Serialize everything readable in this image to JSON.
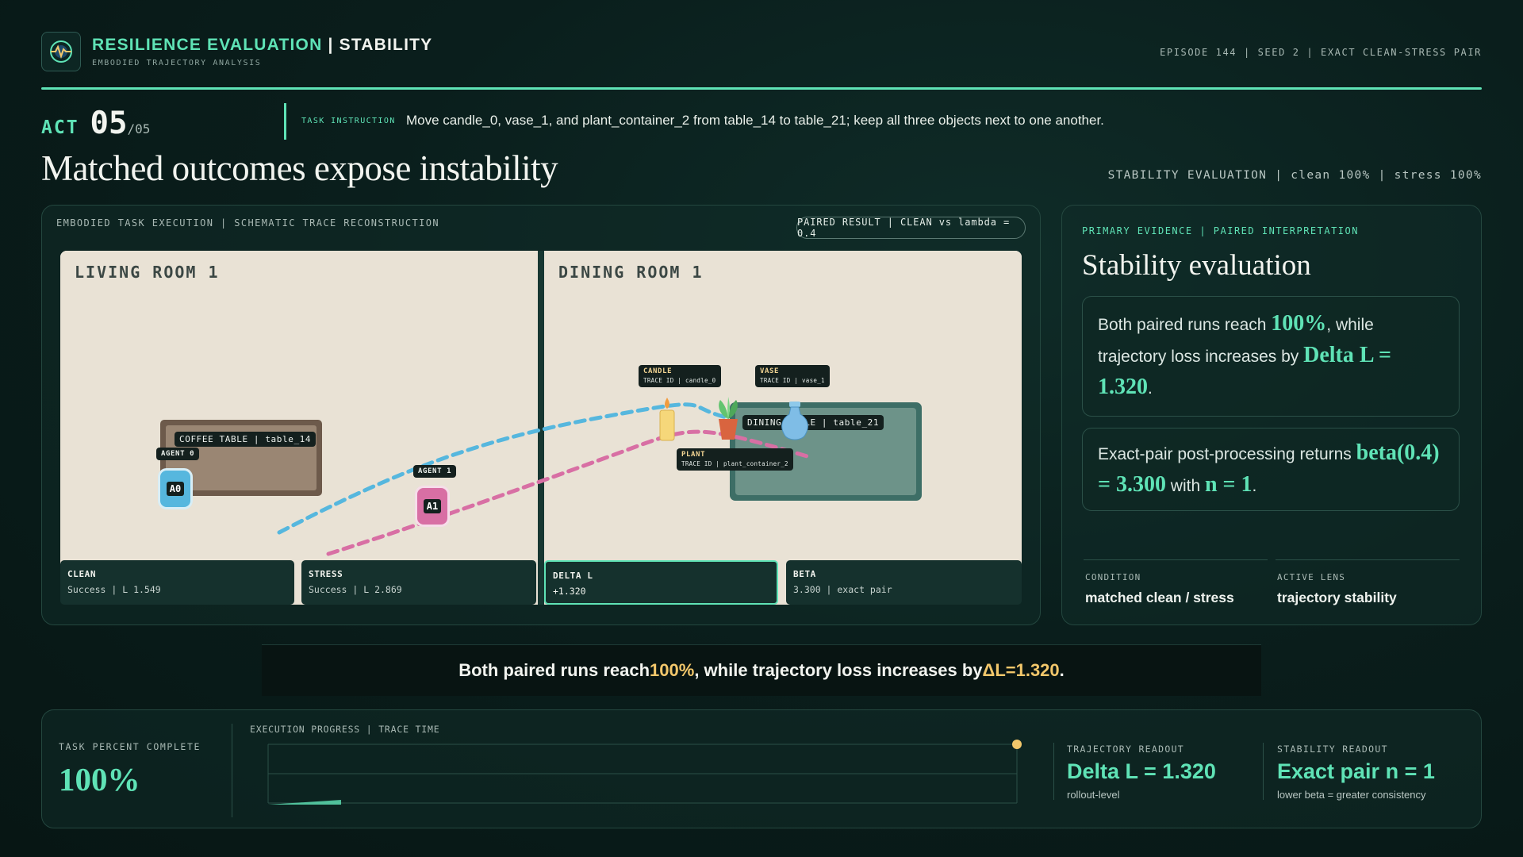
{
  "header": {
    "brand_accent": "RESILIENCE EVALUATION",
    "brand_sep": " | ",
    "brand_rest": "STABILITY",
    "subtitle": "EMBODIED TRAJECTORY ANALYSIS",
    "episode": "EPISODE 144 | SEED 2 | EXACT CLEAN-STRESS PAIR"
  },
  "act": {
    "label": "ACT",
    "number": "05",
    "total": "/05"
  },
  "task": {
    "label": "TASK INSTRUCTION",
    "text": "Move candle_0, vase_1, and plant_container_2 from table_14 to table_21; keep all three objects next to one another."
  },
  "title": "Matched outcomes expose instability",
  "stability_summary": "STABILITY EVALUATION | clean 100% | stress 100%",
  "scene": {
    "label": "EMBODIED TASK EXECUTION | SCHEMATIC TRACE RECONSTRUCTION",
    "paired_result": "PAIRED RESULT | CLEAN vs lambda = 0.4",
    "living_room": "LIVING ROOM 1",
    "dining_room": "DINING ROOM 1",
    "coffee_table": "COFFEE TABLE | table_14",
    "dining_table": "DINING TABLE | table_21",
    "agent0_tag": "AGENT 0",
    "agent0_badge": "A0",
    "agent1_tag": "AGENT 1",
    "agent1_badge": "A1",
    "candle": {
      "name": "CANDLE",
      "trace": "TRACE ID | candle_0"
    },
    "vase": {
      "name": "VASE",
      "trace": "TRACE ID | vase_1"
    },
    "plant": {
      "name": "PLANT",
      "trace": "TRACE ID | plant_container_2"
    },
    "stats": [
      {
        "key": "CLEAN",
        "value": "Success | L 1.549"
      },
      {
        "key": "STRESS",
        "value": "Success | L 2.869"
      },
      {
        "key": "DELTA L",
        "value": "+1.320"
      },
      {
        "key": "BETA",
        "value": "3.300 | exact pair"
      }
    ],
    "colors": {
      "clean": "#56b7de",
      "stress": "#d86fa4"
    }
  },
  "evidence": {
    "label": "PRIMARY EVIDENCE | PAIRED INTERPRETATION",
    "title": "Stability evaluation",
    "box1": {
      "t1": "Both paired runs reach ",
      "e1": "100%",
      "t2": ", while trajectory loss increases by ",
      "e2": "Delta L = 1.320",
      "t3": "."
    },
    "box2": {
      "t1": "Exact-pair post-processing returns ",
      "e1": "beta(0.4) = 3.300",
      "t2": " with ",
      "e2": "n = 1",
      "t3": "."
    },
    "condition_label": "CONDITION",
    "condition_value": "matched clean / stress",
    "lens_label": "ACTIVE LENS",
    "lens_value": "trajectory stability"
  },
  "banner": {
    "t1": "Both paired runs reach ",
    "g1": "100%",
    "t2": ", while trajectory loss increases by ",
    "g2": "ΔL=1.320",
    "t3": "."
  },
  "progress": {
    "task_label": "TASK PERCENT COMPLETE",
    "task_value": "100%",
    "exec_label": "EXECUTION PROGRESS | TRACE TIME",
    "fraction": 1.0,
    "trajectory_label": "TRAJECTORY READOUT",
    "trajectory_value": "Delta L = 1.320",
    "trajectory_sub": "rollout-level",
    "stability_label": "STABILITY READOUT",
    "stability_value": "Exact pair n = 1",
    "stability_sub": "lower beta = greater consistency"
  },
  "colors": {
    "accent": "#5fe3b6",
    "gold": "#f2c76b"
  }
}
